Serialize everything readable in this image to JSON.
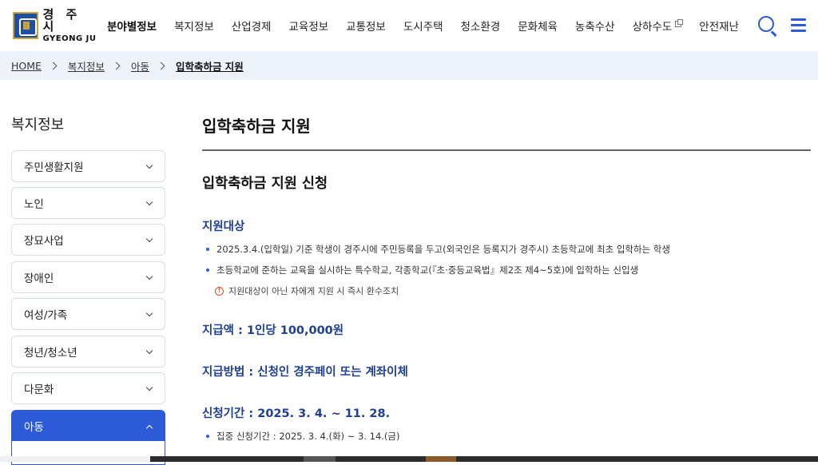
{
  "logo": {
    "korean": "경 주 시",
    "english": "GYEONG JU"
  },
  "gnb": [
    {
      "label": "분야별정보",
      "active": true
    },
    {
      "label": "복지정보"
    },
    {
      "label": "산업경제"
    },
    {
      "label": "교육정보"
    },
    {
      "label": "교통정보"
    },
    {
      "label": "도시주택"
    },
    {
      "label": "청소환경"
    },
    {
      "label": "문화체육"
    },
    {
      "label": "농축수산"
    },
    {
      "label": "상하수도",
      "external": true
    },
    {
      "label": "안전재난"
    }
  ],
  "icons": {
    "search": "search-icon",
    "menu": "hamburger-menu-icon",
    "external": "external-link-icon",
    "warning": "warning-icon"
  },
  "breadcrumb": {
    "home": "HOME",
    "level1": "복지정보",
    "level2": "아동",
    "current": "입학축하금 지원"
  },
  "sidebar": {
    "title": "복지정보",
    "items": [
      {
        "label": "주민생활지원"
      },
      {
        "label": "노인"
      },
      {
        "label": "장묘사업"
      },
      {
        "label": "장애인"
      },
      {
        "label": "여성/가족"
      },
      {
        "label": "청년/청소년"
      },
      {
        "label": "다문화"
      },
      {
        "label": "아동",
        "active": true
      }
    ]
  },
  "content": {
    "page_title": "입학축하금 지원",
    "section_title": "입학축하금 지원 신청",
    "target_heading": "지원대상",
    "target_items": [
      "2025.3.4.(입학일) 기준 학생이 경주시에 주민등록을 두고(외국인은 등록지가 경주시) 초등학교에 최초 입학하는 학생",
      "초등학교에 준하는 교육을 실시하는 특수학교, 각종학교(『초·중등교육법』제2조 제4~5호)에 입학하는 신입생"
    ],
    "target_notice": "지원대상이 아닌 자에게 지원 시 즉시 환수조치",
    "amount": "지급액 : 1인당 100,000원",
    "method": "지급방법 : 신청인 경주페이 또는 계좌이체",
    "period": "신청기간 : 2025. 3. 4. ~ 11. 28.",
    "period_items": [
      "집중 신청기간 : 2025. 3. 4.(화) ~ 3. 14.(금)"
    ]
  },
  "colors": {
    "accent": "#2d5bd8",
    "heading": "#1f3f8f",
    "breadcrumb_bg": "#eef3fb",
    "warning": "#e0501f"
  }
}
